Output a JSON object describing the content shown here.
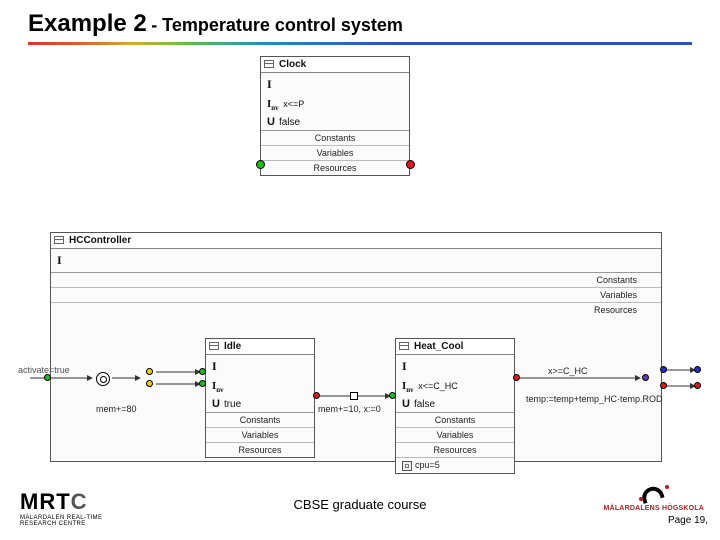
{
  "title": {
    "main": "Example 2",
    "sub": "- Temperature control system"
  },
  "clock_box": {
    "name": "Clock",
    "I": "I",
    "inv_prefix": "I",
    "inv_sub": "nv",
    "inv_expr": "x<=P",
    "U_label": "U",
    "U_expr": "false",
    "sections": [
      "Constants",
      "Variables",
      "Resources"
    ]
  },
  "hc_box": {
    "name": "HCController",
    "I": "I",
    "sections": [
      "Constants",
      "Variables",
      "Resources"
    ]
  },
  "idle_box": {
    "name": "Idle",
    "I": "I",
    "inv_prefix": "I",
    "inv_sub": "nv",
    "U_label": "U",
    "U_expr": "true",
    "sections": [
      "Constants",
      "Variables",
      "Resources"
    ]
  },
  "heat_box": {
    "name": "Heat_Cool",
    "I": "I",
    "inv_prefix": "I",
    "inv_sub": "nv",
    "inv_expr": "x<=C_HC",
    "U_label": "U",
    "U_expr": "false",
    "sections": [
      "Constants",
      "Variables",
      "Resources"
    ],
    "cpu": "cpu=5"
  },
  "edges": {
    "activate": "activate=true",
    "mem80": "mem+=80",
    "mem10": "mem+=10, x:=0",
    "xge": "x>=C_HC",
    "tempcalc": "temp:=temp+temp_HC·temp.ROD"
  },
  "footer": {
    "course": "CBSE graduate course",
    "page": "Page 19,",
    "mrtc_line1": "MÄLARDALEN REAL-TIME",
    "mrtc_line2": "RESEARCH CENTRE",
    "mdh": "MÄLARDALENS HÖGSKOLA"
  }
}
